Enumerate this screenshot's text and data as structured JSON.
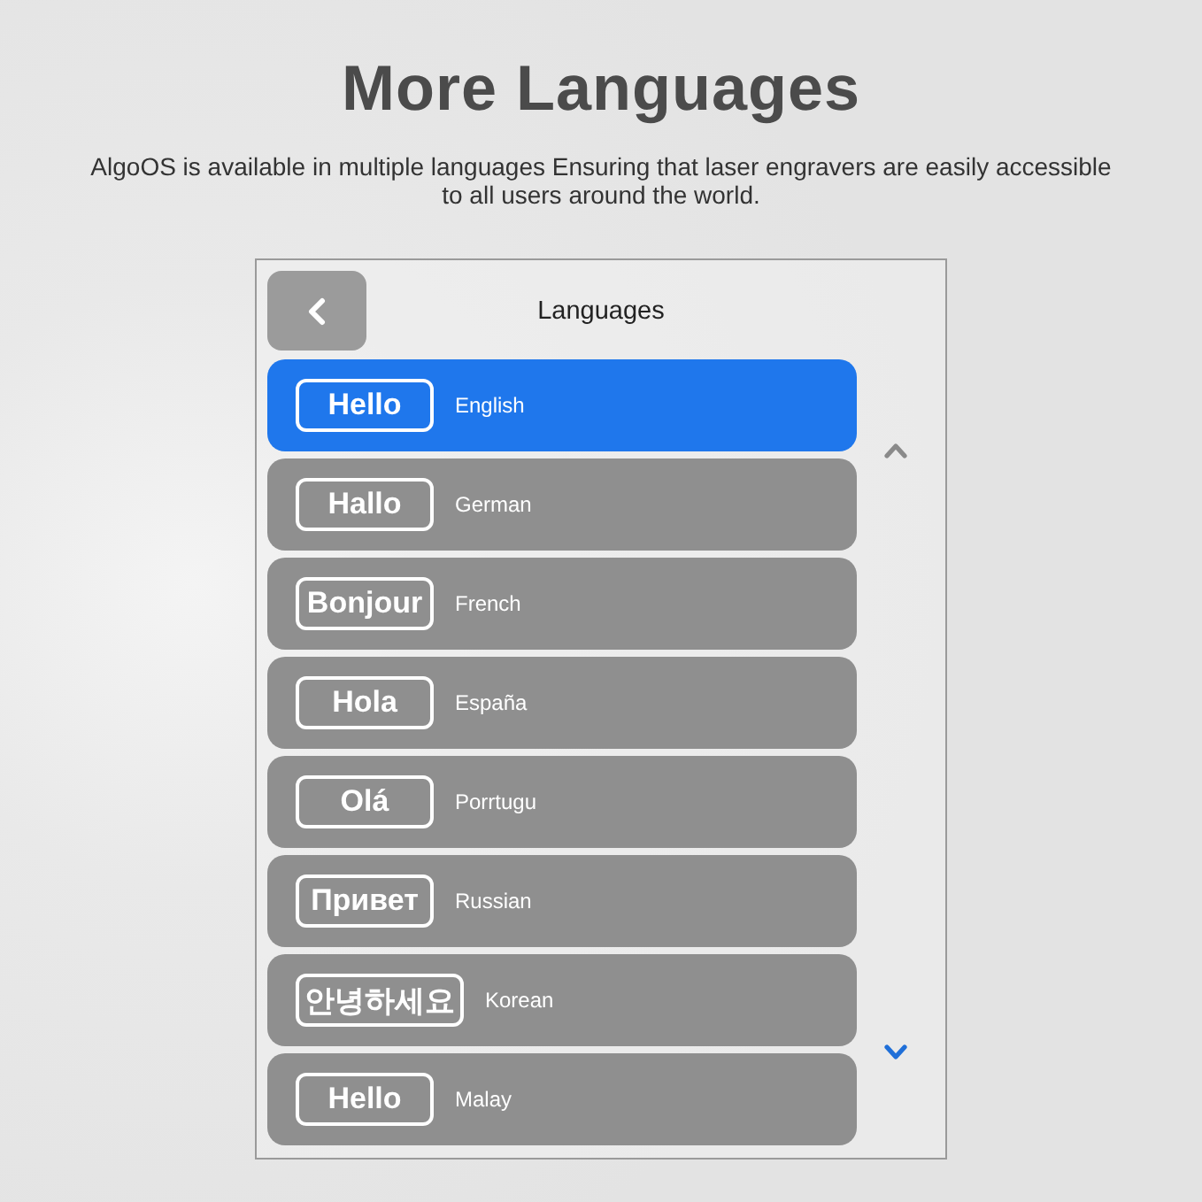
{
  "heading": {
    "title": "More Languages",
    "description": "AlgoOS is available in multiple languages Ensuring that laser engravers are easily accessible to all users around the world."
  },
  "screen": {
    "title": "Languages",
    "scroll_up": {
      "disabled": true
    },
    "scroll_down": {
      "disabled": false
    },
    "languages": [
      {
        "greeting": "Hello",
        "name": "English",
        "selected": true
      },
      {
        "greeting": "Hallo",
        "name": "German",
        "selected": false
      },
      {
        "greeting": "Bonjour",
        "name": "French",
        "selected": false
      },
      {
        "greeting": "Hola",
        "name": "España",
        "selected": false
      },
      {
        "greeting": "Olá",
        "name": "Porrtugu",
        "selected": false
      },
      {
        "greeting": "Привет",
        "name": "Russian",
        "selected": false
      },
      {
        "greeting": "안녕하세요",
        "name": "Korean",
        "selected": false
      },
      {
        "greeting": "Hello",
        "name": "Malay",
        "selected": false
      }
    ]
  }
}
